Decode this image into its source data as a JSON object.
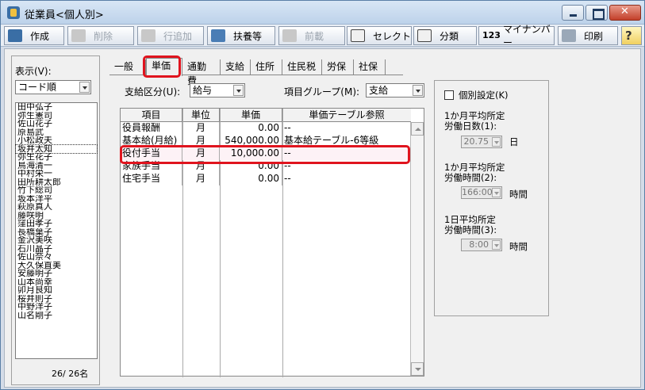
{
  "window": {
    "title": "従業員<個人別>"
  },
  "toolbar": [
    {
      "label": "作成",
      "enabled": true
    },
    {
      "label": "削除",
      "enabled": false
    },
    {
      "label": "行追加",
      "enabled": false
    },
    {
      "label": "扶養等",
      "enabled": true
    },
    {
      "label": "前載",
      "enabled": false
    },
    {
      "label": "セレクト",
      "enabled": true
    },
    {
      "label": "分類",
      "enabled": true
    },
    {
      "label": "マイナンバー",
      "enabled": true
    },
    {
      "label": "印刷",
      "enabled": true
    },
    {
      "label": "",
      "enabled": true
    }
  ],
  "left": {
    "display_label": "表示(V):",
    "sort_value": "コード順",
    "employees": [
      "田中弘子",
      "弥生憲司",
      "佐山花子",
      "原島武",
      "小松政夫",
      "坂井太知",
      "弥生花子",
      "鳥海清一",
      "中村栄一",
      "田所耕太郎",
      "竹下総司",
      "坂本洋平",
      "萩原真人",
      "藤咲明",
      "窪田孝子",
      "長橋葉子",
      "金沢美咲",
      "石川晶子",
      "佐山奈々",
      "大久保直美",
      "安藤明子",
      "山本尚幸",
      "卯月良知",
      "桜井則子",
      "中野洋子",
      "山名剛子"
    ],
    "selected_index": 5,
    "count": "26/ 26名"
  },
  "tabs": [
    "一般",
    "単価",
    "通勤費",
    "支給",
    "住所",
    "住民税",
    "労保",
    "社保"
  ],
  "active_tab": "単価",
  "form": {
    "pay_type_label": "支給区分(U):",
    "pay_type_value": "給与",
    "item_group_label": "項目グループ(M):",
    "item_group_value": "支給"
  },
  "grid": {
    "headers": [
      "項目",
      "単位",
      "単価",
      "単価テーブル参照"
    ],
    "rows": [
      {
        "item": "役員報酬",
        "unit": "月",
        "price": "0.00",
        "ref": "--"
      },
      {
        "item": "基本給(月給)",
        "unit": "月",
        "price": "540,000.00",
        "ref": "基本給テーブル-6等級"
      },
      {
        "item": "役付手当",
        "unit": "月",
        "price": "10,000.00",
        "ref": "--"
      },
      {
        "item": "家族手当",
        "unit": "月",
        "price": "0.00",
        "ref": "--"
      },
      {
        "item": "住宅手当",
        "unit": "月",
        "price": "0.00",
        "ref": "--"
      }
    ],
    "highlight_row": 2
  },
  "side": {
    "individual_setting": "個別設定(K)",
    "monthly_days_label1": "1か月平均所定",
    "monthly_days_label2": "労働日数(1):",
    "monthly_days_value": "20.75",
    "monthly_days_unit": "日",
    "monthly_hours_label1": "1か月平均所定",
    "monthly_hours_label2": "労働時間(2):",
    "monthly_hours_value": "166:00",
    "monthly_hours_unit": "時間",
    "daily_hours_label1": "1日平均所定",
    "daily_hours_label2": "労働時間(3):",
    "daily_hours_value": "8:00",
    "daily_hours_unit": "時間"
  },
  "colors": {
    "highlight": "#e0141e",
    "selected_row_bg": "#fdf2f6"
  }
}
